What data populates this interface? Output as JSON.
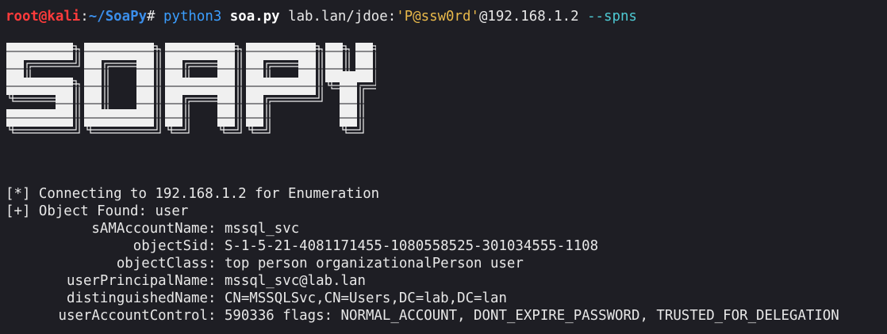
{
  "prompt": {
    "user": "root",
    "at": "@",
    "host": "kali",
    "colon": ":",
    "path": "~/SoaPy",
    "hash": "#",
    "cmd_python": "python3",
    "cmd_file": "soa.py",
    "cmd_target_pre": "lab.lan/jdoe:",
    "cmd_password": "'P@ssw0rd'",
    "cmd_target_post": "@192.168.1.2",
    "cmd_flag": "--spns"
  },
  "banner": {
    "letters": [
      "S",
      "O",
      "A",
      "P",
      "Y"
    ],
    "color": "#f0f0f0"
  },
  "output": {
    "connecting": "[*] Connecting to 192.168.1.2 for Enumeration",
    "found": "[+] Object Found: user",
    "attributes": [
      {
        "key": "sAMAccountName",
        "value": "mssql_svc"
      },
      {
        "key": "objectSid",
        "value": "S-1-5-21-4081171455-1080558525-301034555-1108"
      },
      {
        "key": "objectClass",
        "value": "top person organizationalPerson user"
      },
      {
        "key": "userPrincipalName",
        "value": "mssql_svc@lab.lan"
      },
      {
        "key": "distinguishedName",
        "value": "CN=MSSQLSvc,CN=Users,DC=lab,DC=lan"
      },
      {
        "key": "userAccountControl",
        "value": "590336 flags: NORMAL_ACCOUNT, DONT_EXPIRE_PASSWORD, TRUSTED_FOR_DELEGATION"
      }
    ]
  },
  "colors": {
    "background": "#1e1e24",
    "text": "#e8e8e8",
    "prompt_red": "#ff3b3b",
    "path_blue": "#3b8eea",
    "string_yellow": "#e8b84a",
    "flag_cyan": "#4ec9d3"
  }
}
